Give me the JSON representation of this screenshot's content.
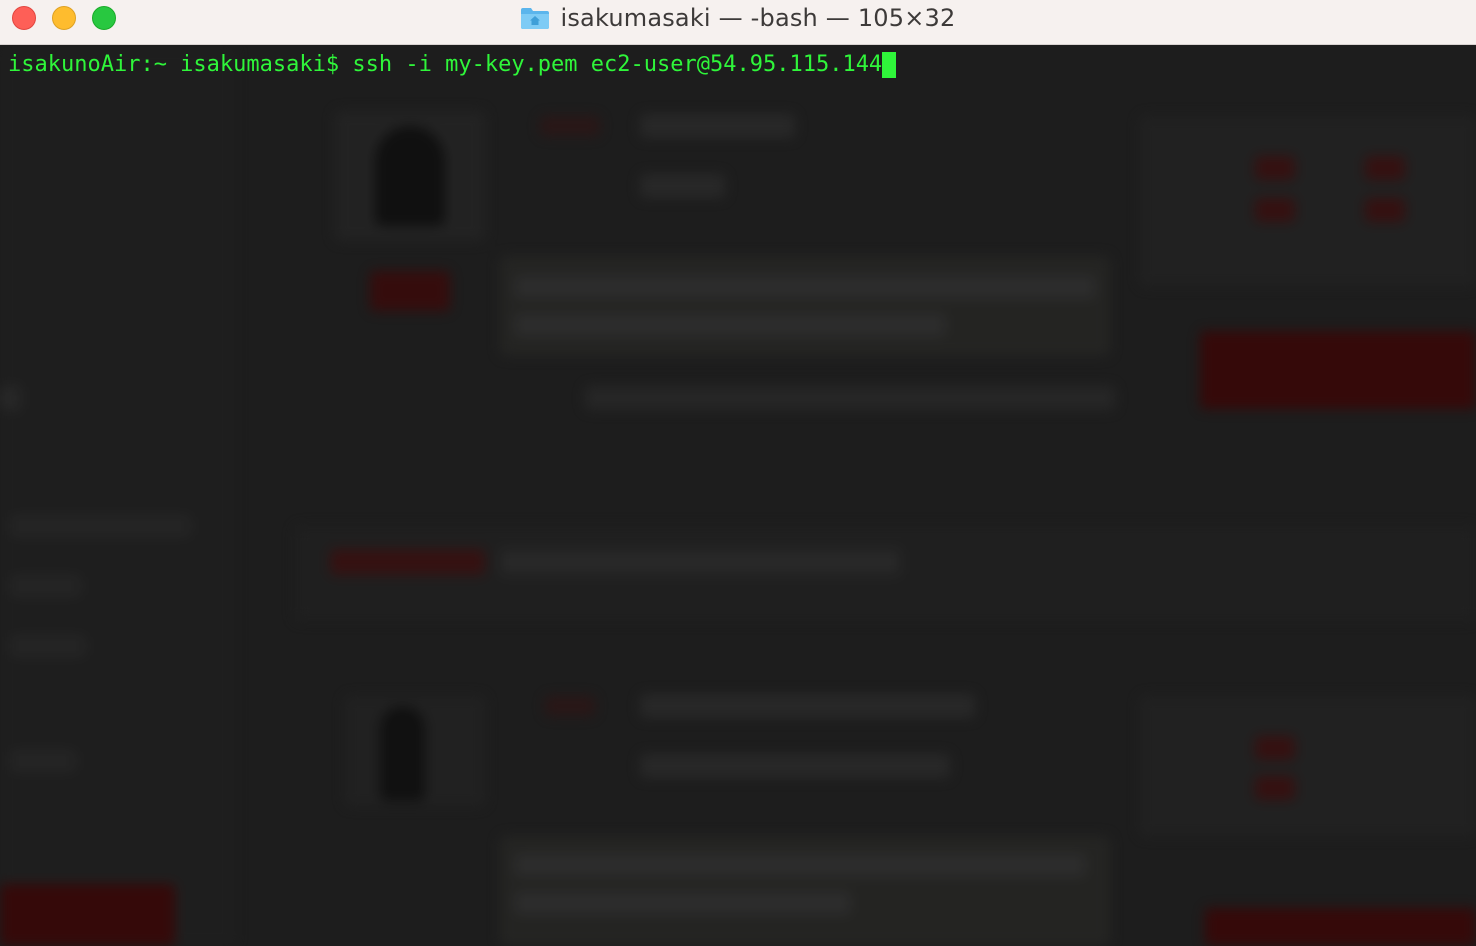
{
  "window": {
    "title": "isakumasaki — -bash — 105×32",
    "folder_icon": "home-folder-icon",
    "controls": [
      "close",
      "minimize",
      "zoom"
    ]
  },
  "terminal": {
    "prompt": "isakunoAir:~ isakumasaki$ ",
    "command": "ssh -i my-key.pem ec2-user@54.95.115.144",
    "text_color": "#2ff53a",
    "background": "#1d1d1d"
  },
  "colors": {
    "titlebar_bg": "#f6f1ef",
    "close": "#fe5f57",
    "minimize": "#febc2e",
    "zoom": "#28c840"
  }
}
